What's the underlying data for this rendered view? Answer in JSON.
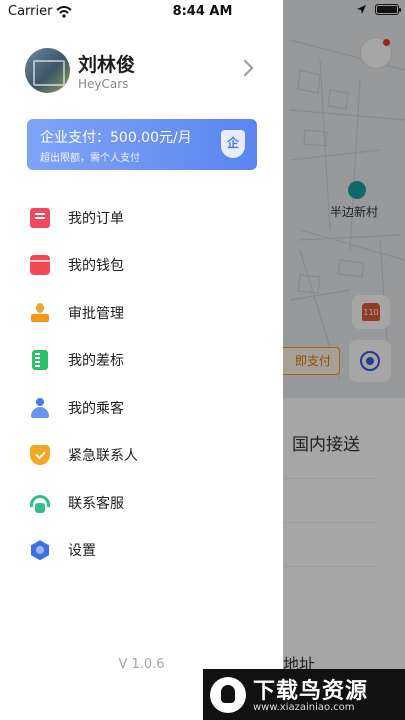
{
  "status_bar": {
    "carrier": "Carrier",
    "time": "8:44 AM",
    "wifi_icon": "wifi-icon",
    "location_icon": "location-arrow-icon",
    "battery_level": 1.0
  },
  "map": {
    "poi_label": "半边新村",
    "pay_chip": "即支付",
    "sheet_tab": "国内接送",
    "address_hint": "地址",
    "alarm_icon": "alarm-icon",
    "locate_icon": "locate-icon",
    "chat_icon": "chat-icon"
  },
  "drawer": {
    "profile": {
      "name": "刘林俊",
      "company": "HeyCars"
    },
    "enterprise_card": {
      "title": "企业支付：500.00元/月",
      "subtitle": "超出限额，需个人支付",
      "badge": "企"
    },
    "menu": [
      {
        "label": "我的订单",
        "icon": "order-icon"
      },
      {
        "label": "我的钱包",
        "icon": "wallet-icon"
      },
      {
        "label": "审批管理",
        "icon": "approval-stamp-icon"
      },
      {
        "label": "我的差标",
        "icon": "travel-standard-icon"
      },
      {
        "label": "我的乘客",
        "icon": "passenger-icon"
      },
      {
        "label": "紧急联系人",
        "icon": "emergency-shield-icon"
      },
      {
        "label": "联系客服",
        "icon": "customer-service-icon"
      },
      {
        "label": "设置",
        "icon": "settings-icon"
      }
    ],
    "version": "V 1.0.6"
  },
  "watermark": {
    "title": "下载鸟资源",
    "url": "www.xiazainiao.com"
  },
  "colors": {
    "card_gradient_start": "#7ea4f8",
    "card_gradient_end": "#5a85ef",
    "accent_blue": "#3a5bd9",
    "pay_chip_orange": "#f39b2a"
  }
}
